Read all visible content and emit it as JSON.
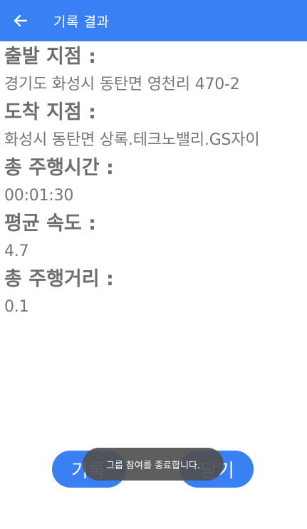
{
  "app_bar": {
    "title": "기록 결과",
    "back_icon": "arrow-left-icon"
  },
  "fields": {
    "start_label": "출발 지점 :",
    "start_value": "경기도 화성시 동탄면 영천리 470-2",
    "end_label": "도착 지점 :",
    "end_value": "화성시 동탄면 상록.테크노밸리.GS자이",
    "time_label": "총 주행시간 :",
    "time_value": "00:01:30",
    "speed_label": "평균 속도 :",
    "speed_value": "4.7",
    "distance_label": "총 주행거리 :",
    "distance_value": "0.1"
  },
  "buttons": {
    "record_label": "기록",
    "close_label": "닫기"
  },
  "toast": {
    "message": "그룹 참여를 종료합니다."
  },
  "colors": {
    "primary": "#3a80f5",
    "label_text": "#6e6e6e",
    "value_text": "#757575",
    "toast_bg": "#505050"
  }
}
